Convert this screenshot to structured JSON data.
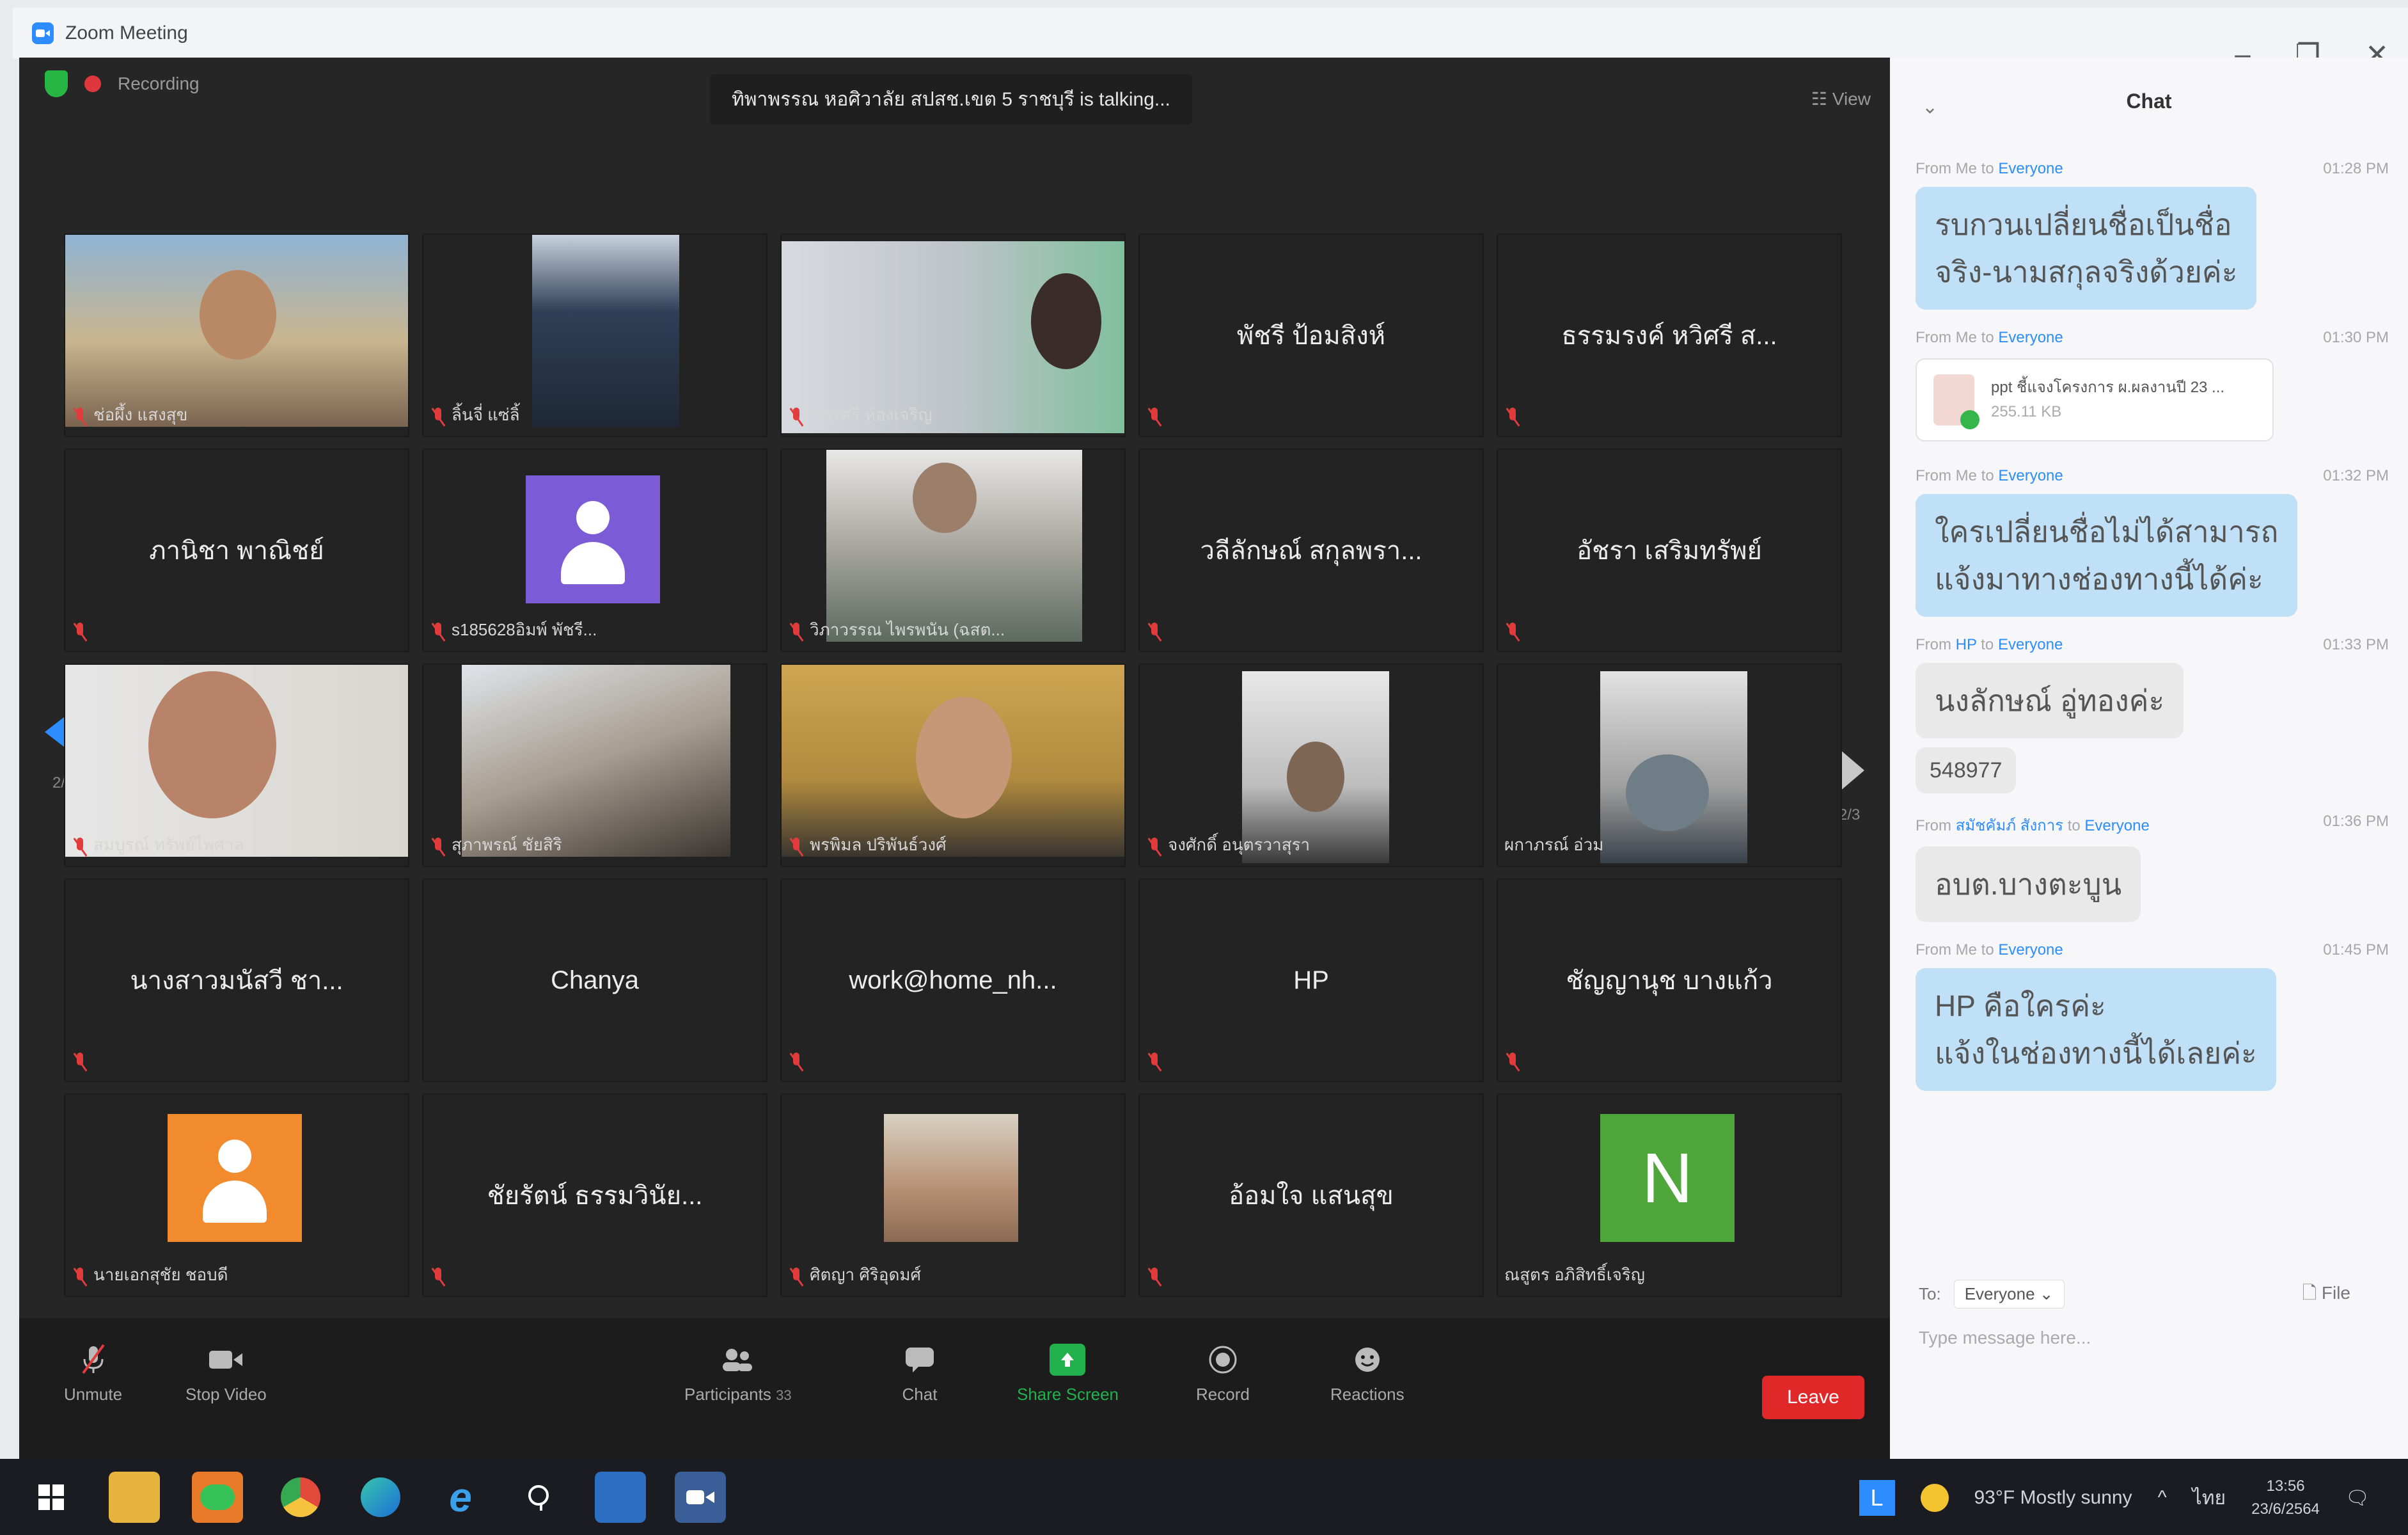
{
  "window": {
    "title": "Zoom Meeting"
  },
  "status": {
    "recording": "Recording",
    "talking": "ทิพาพรรณ หอศิวาลัย สปสช.เขต 5 ราชบุรี is talking...",
    "view": "View"
  },
  "pagination": {
    "left": "2/3",
    "right": "2/3"
  },
  "participants": [
    {
      "name": "ช่อผึ้ง แสงสุข",
      "type": "video"
    },
    {
      "name": "ลิ้นจี่ แซ่ลิ้",
      "type": "video"
    },
    {
      "name": "ภัทรศรี ห้องเจริญ",
      "type": "video"
    },
    {
      "name": "พัชรี ป้อมสิงห์",
      "type": "name"
    },
    {
      "name": "ธรรมรงค์ หวิศรี ส...",
      "type": "name"
    },
    {
      "name": "ภานิชา พาณิชย์",
      "type": "name"
    },
    {
      "name": "s185628อิมพ์ พัชรี...",
      "type": "avatar"
    },
    {
      "name": "วิภาวรรณ ไพรพนัน (ฉสต...",
      "type": "video"
    },
    {
      "name": "วลีลักษณ์ สกุลพรา...",
      "type": "name"
    },
    {
      "name": "อัชรา เสริมทรัพย์",
      "type": "name"
    },
    {
      "name": "สมบูรณ์ ทรัพย์ไพศาล",
      "type": "video"
    },
    {
      "name": "สุภาพรณ์ ชัยสิริ",
      "type": "video"
    },
    {
      "name": "พรพิมล ปริพันธ์วงศ์",
      "type": "video"
    },
    {
      "name": "จงศักดิ์ อนุตรวาสุรา",
      "type": "video"
    },
    {
      "name": "ผกาภรณ์ อ่วม",
      "type": "video"
    },
    {
      "name": "นางสาวมนัสวี ชา...",
      "type": "name"
    },
    {
      "name": "Chanya",
      "type": "name"
    },
    {
      "name": "work@home_nh...",
      "type": "name"
    },
    {
      "name": "HP",
      "type": "name"
    },
    {
      "name": "ชัญญานุช บางแก้ว",
      "type": "name"
    },
    {
      "name": "นายเอกสุชัย ชอบดี",
      "type": "avatar"
    },
    {
      "name": "ชัยรัตน์ ธรรมวินัย...",
      "type": "name"
    },
    {
      "name": "ศิตญา ศิริอุดมศ์",
      "type": "video"
    },
    {
      "name": "อ้อมใจ แสนสุข",
      "type": "name"
    },
    {
      "name": "ณสูตร อภิสิทธิ์เจริญ",
      "type": "letter",
      "letter": "N"
    }
  ],
  "toolbar": {
    "unmute": "Unmute",
    "stop_video": "Stop Video",
    "participants": "Participants",
    "participants_count": "33",
    "chat": "Chat",
    "share_screen": "Share Screen",
    "record": "Record",
    "reactions": "Reactions",
    "leave": "Leave"
  },
  "chat": {
    "header": "Chat",
    "messages": [
      {
        "from": "From Me to",
        "to": "Everyone",
        "time": "01:28 PM",
        "text1": "รบกวนเปลี่ยนชื่อเป็นชื่อ",
        "text2": "จริง-นามสกุลจริงด้วยค่ะ"
      },
      {
        "from": "From Me to",
        "to": "Everyone",
        "time": "01:30 PM",
        "file_name": "ppt ชี้แจงโครงการ ผ.ผลงานปี 23 ...",
        "file_size": "255.11 KB"
      },
      {
        "from": "From Me to",
        "to": "Everyone",
        "time": "01:32 PM",
        "text1": "ใครเปลี่ยนชื่อไม่ได้สามารถ",
        "text2": "แจ้งมาทางช่องทางนี้ได้ค่ะ"
      },
      {
        "from": "From",
        "sender": "HP",
        "to": "Everyone",
        "time": "01:33 PM",
        "text1": "นงลักษณ์ อู่ทองค่ะ",
        "text2": "548977"
      },
      {
        "from": "From",
        "sender": "สมัชคัมภ์ สังการ",
        "to": "Everyone",
        "time": "01:36 PM",
        "text1": "อบต.บางตะบูน"
      },
      {
        "from": "From Me to",
        "to": "Everyone",
        "time": "01:45 PM",
        "text1": "HP คือใครค่ะ",
        "text2": "แจ้งในช่องทางนี้ได้เลยค่ะ"
      }
    ],
    "to_label": "To:",
    "to_value": "Everyone",
    "file_label": "File",
    "placeholder": "Type message here..."
  },
  "taskbar": {
    "weather": "93°F  Mostly sunny",
    "lang": "ไทย",
    "time": "13:56",
    "date": "23/6/2564"
  },
  "colors": {
    "zoom_blue": "#2d8cff",
    "leave_red": "#e02828",
    "share_green": "#22b14c",
    "mic_red": "#e23b3b"
  }
}
